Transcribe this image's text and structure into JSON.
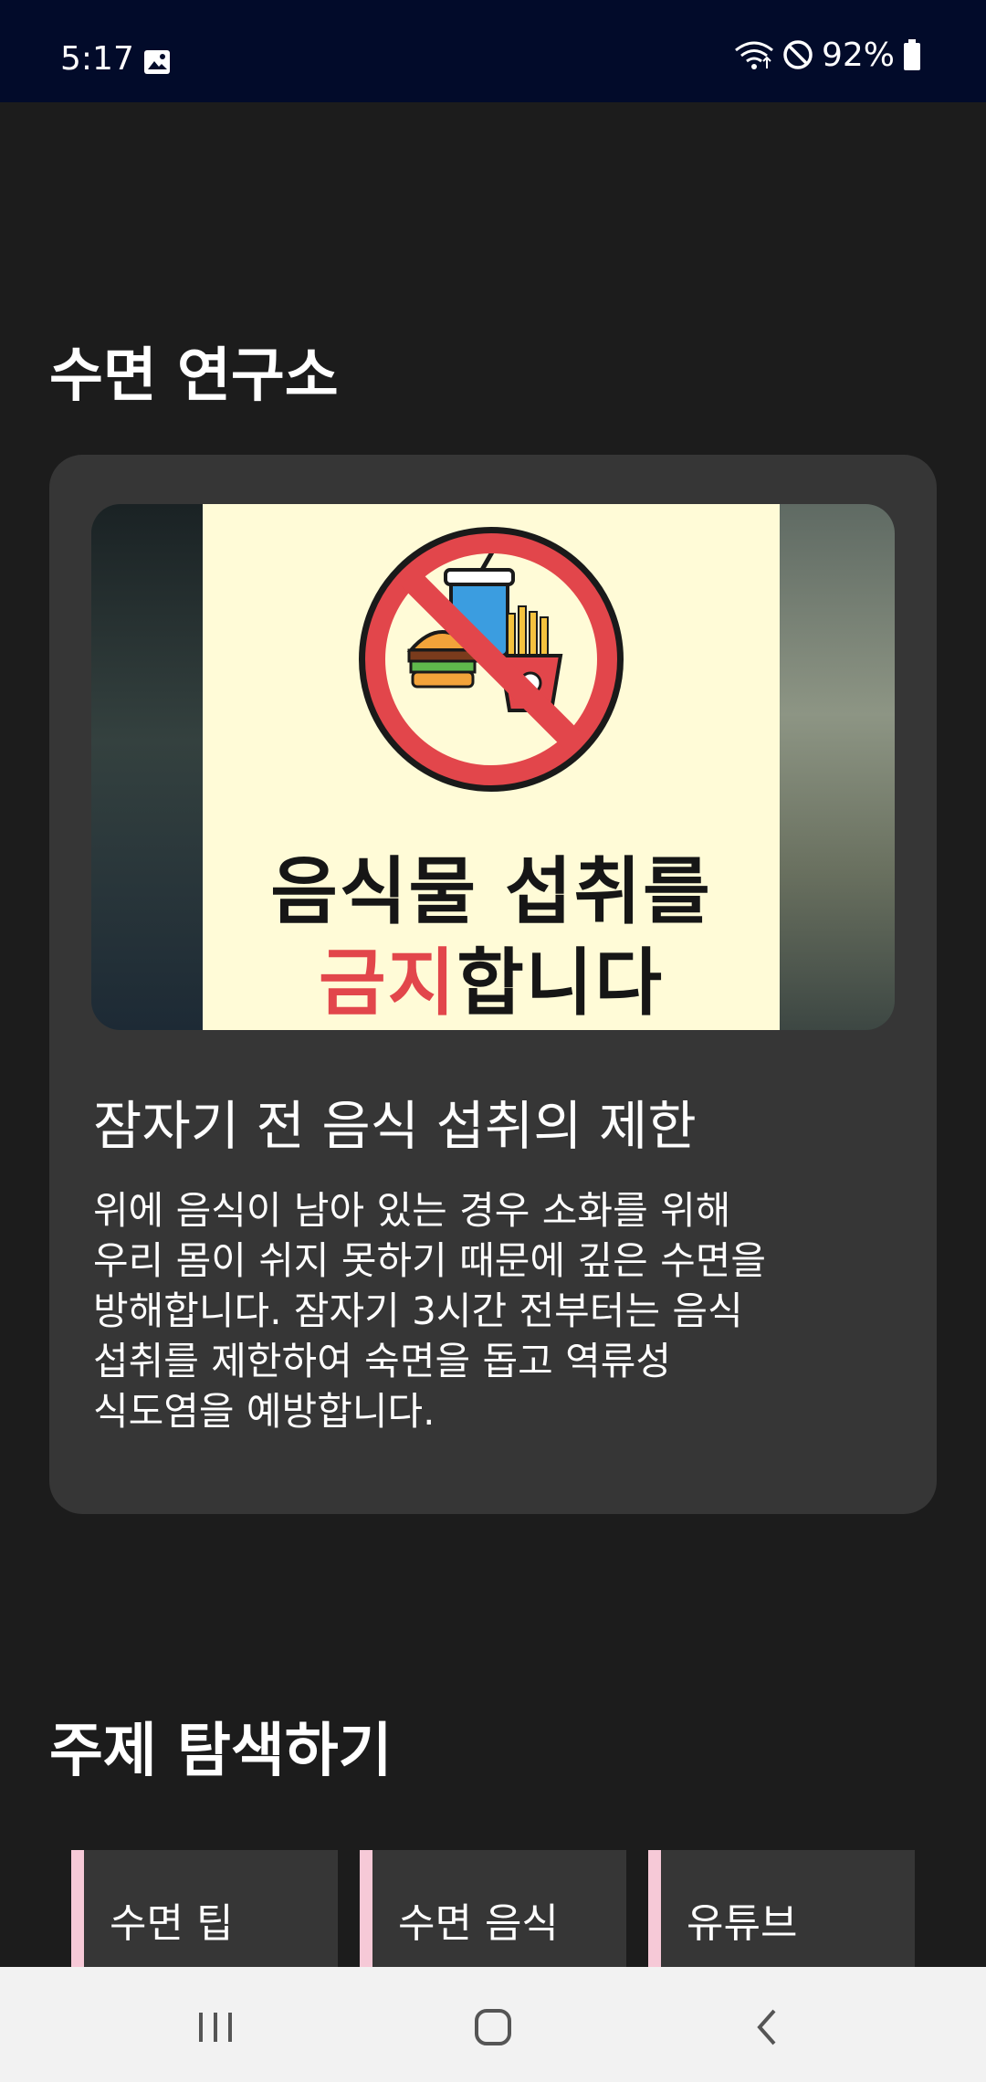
{
  "status_bar": {
    "time": "5:17",
    "battery": "92%",
    "icons": [
      "gallery-icon",
      "wifi-icon",
      "do-not-disturb-icon",
      "battery-icon"
    ]
  },
  "sleep_lab": {
    "title": "수면 연구소",
    "card": {
      "image_text_line1": "음식물 섭취를",
      "image_text_red": "금지",
      "image_text_rest": "합니다",
      "heading": "잠자기 전 음식 섭취의 제한",
      "body_lines": [
        "위에 음식이 남아 있는 경우 소화를 위해",
        "우리 몸이 쉬지 못하기 때문에 깊은 수면을",
        "방해합니다. 잠자기 3시간 전부터는 음식",
        "섭취를 제한하여 숙면을 돕고 역류성",
        "식도염을 예방합니다."
      ]
    }
  },
  "topics": {
    "title": "주제 탐색하기",
    "items": [
      {
        "label": "수면 팁"
      },
      {
        "label": "수면 음식"
      },
      {
        "label": "유튜브"
      }
    ]
  },
  "nav": {
    "icons": [
      "recent-apps-icon",
      "home-icon",
      "back-icon"
    ]
  },
  "colors": {
    "background": "#1c1c1c",
    "card": "#363636",
    "status_bar": "#020b2a",
    "chip_accent": "#f6c9d7",
    "prohibit_red": "#e2464b"
  }
}
